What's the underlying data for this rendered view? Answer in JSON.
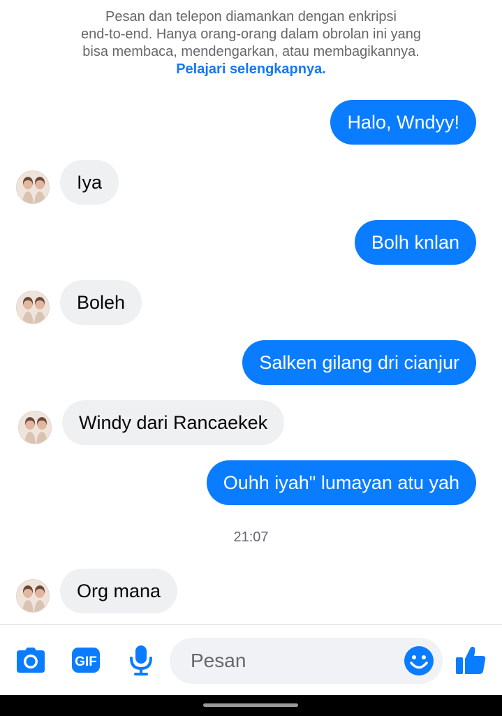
{
  "notice": {
    "line1": "Pesan dan telepon diamankan dengan enkripsi",
    "line2": "end-to-end. Hanya orang-orang dalam obrolan ini yang",
    "line3": "bisa membaca, mendengarkan, atau membagikannya.",
    "learn_more": "Pelajari selengkapnya."
  },
  "messages": [
    {
      "direction": "outgoing",
      "text": "Halo, Wndyy!"
    },
    {
      "direction": "incoming",
      "text": "Iya"
    },
    {
      "direction": "outgoing",
      "text": "Bolh knlan"
    },
    {
      "direction": "incoming",
      "text": "Boleh"
    },
    {
      "direction": "outgoing",
      "text": "Salken gilang dri cianjur"
    },
    {
      "direction": "incoming",
      "text": "Windy dari Rancaekek"
    },
    {
      "direction": "outgoing",
      "text": "Ouhh iyah\" lumayan atu yah"
    },
    {
      "direction": "incoming",
      "text": "Org mana"
    }
  ],
  "timestamp": "21:07",
  "composer": {
    "placeholder": "Pesan",
    "icons": [
      "camera-icon",
      "gif-icon",
      "microphone-icon",
      "emoji-icon",
      "thumbs-up-icon"
    ],
    "gif_label": "GIF"
  },
  "colors": {
    "accent": "#0a7cff",
    "incoming_bubble": "#eff0f2",
    "link": "#1877f2"
  }
}
